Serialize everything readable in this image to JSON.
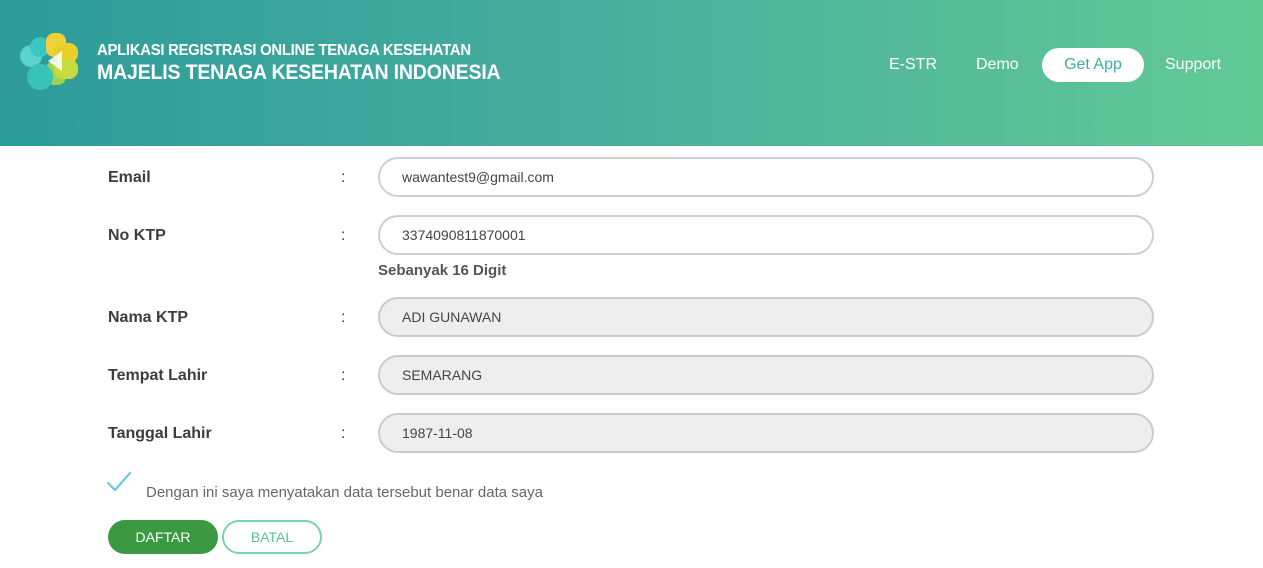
{
  "header": {
    "brand_line1": "APLIKASI REGISTRASI ONLINE TENAGA KESEHATAN",
    "brand_line2": "MAJELIS TENAGA KESEHATAN INDONESIA",
    "logo_icon": "mtki-logo-icon",
    "nav": [
      {
        "label": "E-STR"
      },
      {
        "label": "Demo"
      },
      {
        "label": "Get App"
      },
      {
        "label": "Support"
      }
    ]
  },
  "form": {
    "colon": ":",
    "fields": [
      {
        "label": "Email",
        "value": "wawantest9@gmail.com"
      },
      {
        "label": "No KTP",
        "value": "3374090811870001",
        "hint": "Sebanyak 16 Digit"
      },
      {
        "label": "Nama KTP",
        "value": "ADI GUNAWAN"
      },
      {
        "label": "Tempat Lahir",
        "value": "SEMARANG"
      },
      {
        "label": "Tanggal Lahir",
        "value": "1987-11-08"
      }
    ],
    "agreement": "Dengan ini saya menyatakan data tersebut benar data saya",
    "submit_label": "DAFTAR",
    "cancel_label": "BATAL"
  },
  "colors": {
    "header_start": "#2c9b9a",
    "header_end": "#62c995",
    "submit": "#3b9a41",
    "cancel_border": "#7ad3a9",
    "check": "#6cc6e6"
  }
}
